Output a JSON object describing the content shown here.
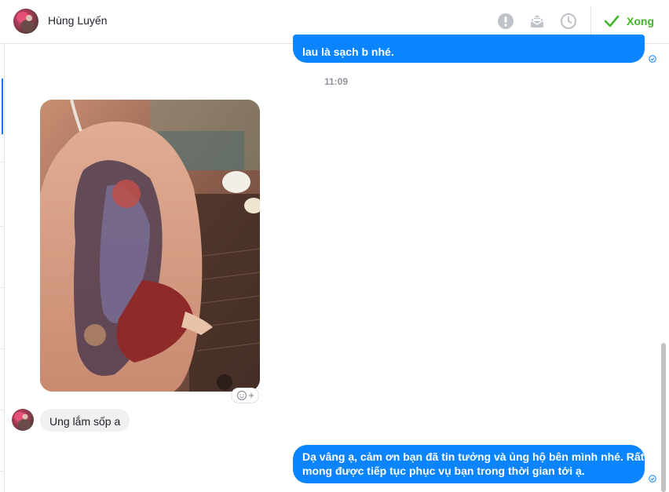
{
  "header": {
    "contact_name": "Hùng Luyến",
    "done_label": "Xong",
    "icons": [
      "alert-icon",
      "mail-icon",
      "clock-icon",
      "check-icon"
    ],
    "accent_color": "#42b72a"
  },
  "messages": {
    "outgoing_1_text": "lau là sạch b nhé.",
    "timestamp": "11:09",
    "incoming_text": "Ung lắm sốp a",
    "outgoing_2_line1": "Dạ vâng ạ, cảm ơn bạn đã tin tưởng và ủng hộ bên mình nhé. Rất",
    "outgoing_2_line2": "mong được tiếp tục phục vụ bạn trong thời gian tới ạ.",
    "bubble_color": "#0a84ff"
  }
}
